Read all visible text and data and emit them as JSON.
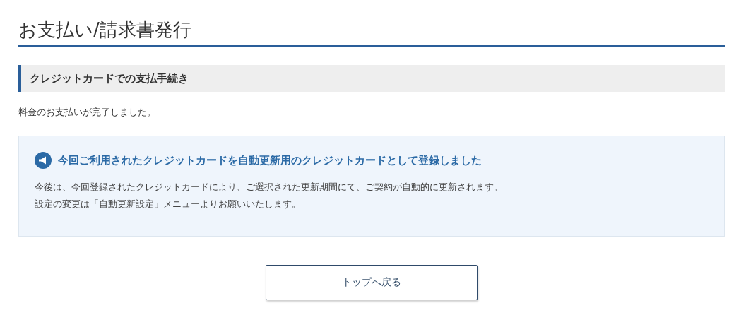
{
  "page_title": "お支払い/請求書発行",
  "section": {
    "heading": "クレジットカードでの支払手続き",
    "message": "料金のお支払いが完了しました。"
  },
  "notice": {
    "title": "今回ご利用されたクレジットカードを自動更新用のクレジットカードとして登録しました",
    "lines": [
      "今後は、今回登録されたクレジットカードにより、ご選択された更新期間にて、ご契約が自動的に更新されます。",
      "設定の変更は「自動更新設定」メニューよりお願いいたします。"
    ]
  },
  "buttons": [
    {
      "label": "トップへ戻る"
    }
  ]
}
